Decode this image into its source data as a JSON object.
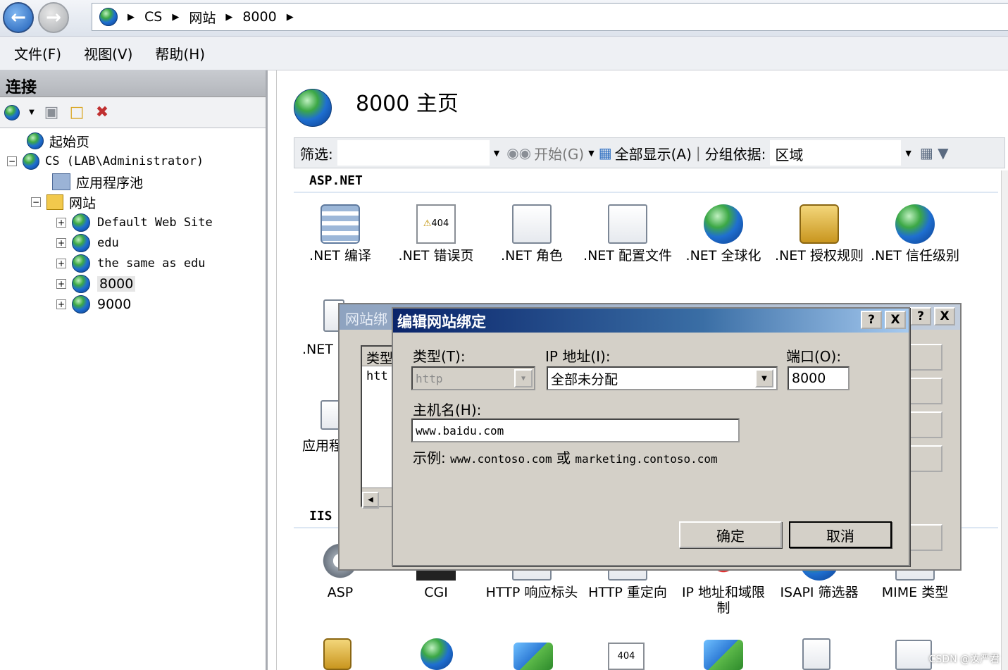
{
  "address_bar": {
    "crumbs": [
      "CS",
      "网站",
      "8000"
    ]
  },
  "menu": {
    "file": "文件(F)",
    "view": "视图(V)",
    "help": "帮助(H)"
  },
  "connections": {
    "title": "连接",
    "tree": {
      "start_page": "起始页",
      "server": "CS (LAB\\Administrator)",
      "app_pools": "应用程序池",
      "sites": "网站",
      "site_list": [
        "Default Web Site",
        "edu",
        "the same as edu",
        "8000",
        "9000"
      ]
    }
  },
  "main": {
    "title": "8000 主页",
    "filter": {
      "label": "筛选:",
      "start": "开始(G)",
      "show_all": "全部显示(A)",
      "group_by_label": "分组依据:",
      "group_by_value": "区域"
    },
    "groups": {
      "aspnet": "ASP.NET",
      "iis": "IIS"
    },
    "aspnet_features": [
      ".NET 编译",
      ".NET 错误页",
      ".NET 角色",
      ".NET 配置文件",
      ".NET 全球化",
      ".NET 授权规则",
      ".NET 信任级别"
    ],
    "partial_features": {
      "net": ".NET",
      "app": "应用程"
    },
    "iis_features": [
      "ASP",
      "CGI",
      "HTTP 响应标头",
      "HTTP 重定向",
      "IP 地址和域限制",
      "ISAPI 筛选器",
      "MIME 类型"
    ],
    "icon_404": "404"
  },
  "bg_dialog": {
    "title": "网站绑",
    "list_header": "类型",
    "list_row": "htt"
  },
  "edit_dialog": {
    "title": "编辑网站绑定",
    "type_label": "类型(T):",
    "type_value": "http",
    "ip_label": "IP 地址(I):",
    "ip_value": "全部未分配",
    "port_label": "端口(O):",
    "port_value": "8000",
    "host_label": "主机名(H):",
    "host_value": "www.baidu.com",
    "example_prefix": "示例:",
    "example_1": "www.contoso.com",
    "example_or": "或",
    "example_2": "marketing.contoso.com",
    "ok": "确定",
    "cancel": "取消",
    "help_btn": "?",
    "close_btn": "X"
  },
  "watermark": "CSDN @汝严君"
}
